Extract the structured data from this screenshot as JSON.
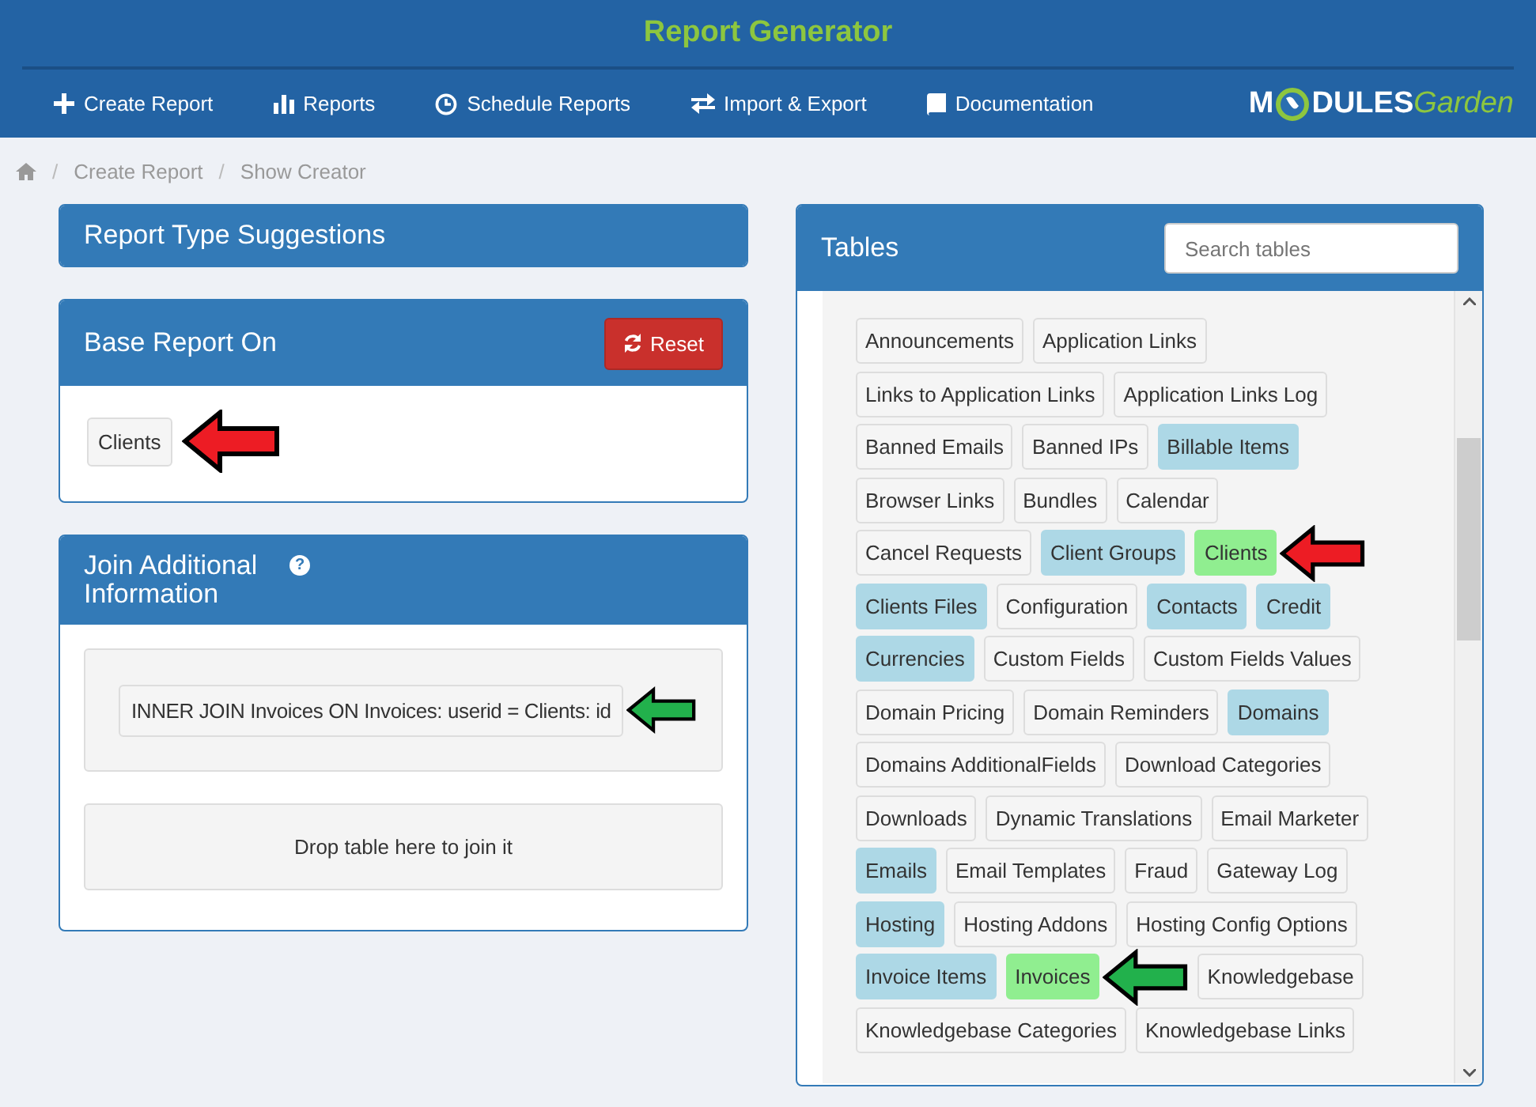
{
  "header": {
    "title": "Report Generator",
    "nav": [
      {
        "label": "Create Report"
      },
      {
        "label": "Reports"
      },
      {
        "label": "Schedule Reports"
      },
      {
        "label": "Import & Export"
      },
      {
        "label": "Documentation"
      }
    ],
    "logo": {
      "first": "M",
      "rest": "DULES",
      "second": "Garden"
    }
  },
  "breadcrumb": {
    "separator": "/",
    "items": [
      "Create Report",
      "Show Creator"
    ]
  },
  "suggestions": {
    "title": "Report Type Suggestions"
  },
  "base": {
    "title": "Base Report On",
    "reset": "Reset",
    "item": {
      "label": "Clients",
      "arrow": {
        "color": "#ed1c24"
      }
    }
  },
  "join": {
    "title": "Join Additional Information",
    "help": "?",
    "joins": [
      {
        "label": "INNER JOIN Invoices ON Invoices: userid = Clients: id",
        "arrow": {
          "color": "#22b14c"
        }
      }
    ],
    "drop": "Drop table here to join it"
  },
  "tables": {
    "title": "Tables",
    "search": {
      "placeholder": "Search tables"
    },
    "items": [
      {
        "label": "Announcements"
      },
      {
        "label": "Application Links"
      },
      {
        "label": "Links to Application Links"
      },
      {
        "label": "Application Links Log"
      },
      {
        "label": "Banned Emails"
      },
      {
        "label": "Banned IPs"
      },
      {
        "label": "Billable Items",
        "color": "#add8e6"
      },
      {
        "label": "Browser Links"
      },
      {
        "label": "Bundles"
      },
      {
        "label": "Calendar"
      },
      {
        "label": "Cancel Requests"
      },
      {
        "label": "Client Groups",
        "color": "#add8e6"
      },
      {
        "label": "Clients",
        "color": "#90ee90",
        "arrow": {
          "color": "#ed1c24"
        }
      },
      {
        "label": "Clients Files",
        "color": "#add8e6"
      },
      {
        "label": "Configuration"
      },
      {
        "label": "Contacts",
        "color": "#add8e6"
      },
      {
        "label": "Credit",
        "color": "#add8e6"
      },
      {
        "label": "Currencies",
        "color": "#add8e6"
      },
      {
        "label": "Custom Fields"
      },
      {
        "label": "Custom Fields Values"
      },
      {
        "label": "Domain Pricing"
      },
      {
        "label": "Domain Reminders"
      },
      {
        "label": "Domains",
        "color": "#add8e6"
      },
      {
        "label": "Domains AdditionalFields"
      },
      {
        "label": "Download Categories"
      },
      {
        "label": "Downloads"
      },
      {
        "label": "Dynamic Translations"
      },
      {
        "label": "Email Marketer"
      },
      {
        "label": "Emails",
        "color": "#add8e6"
      },
      {
        "label": "Email Templates"
      },
      {
        "label": "Fraud"
      },
      {
        "label": "Gateway Log"
      },
      {
        "label": "Hosting",
        "color": "#add8e6"
      },
      {
        "label": "Hosting Addons"
      },
      {
        "label": "Hosting Config Options"
      },
      {
        "label": "Invoice Items",
        "color": "#add8e6"
      },
      {
        "label": "Invoices",
        "color": "#90ee90",
        "arrow": {
          "color": "#22b14c"
        }
      },
      {
        "label": "Knowledgebase"
      },
      {
        "label": "Knowledgebase Categories"
      },
      {
        "label": "Knowledgebase Links"
      }
    ]
  }
}
